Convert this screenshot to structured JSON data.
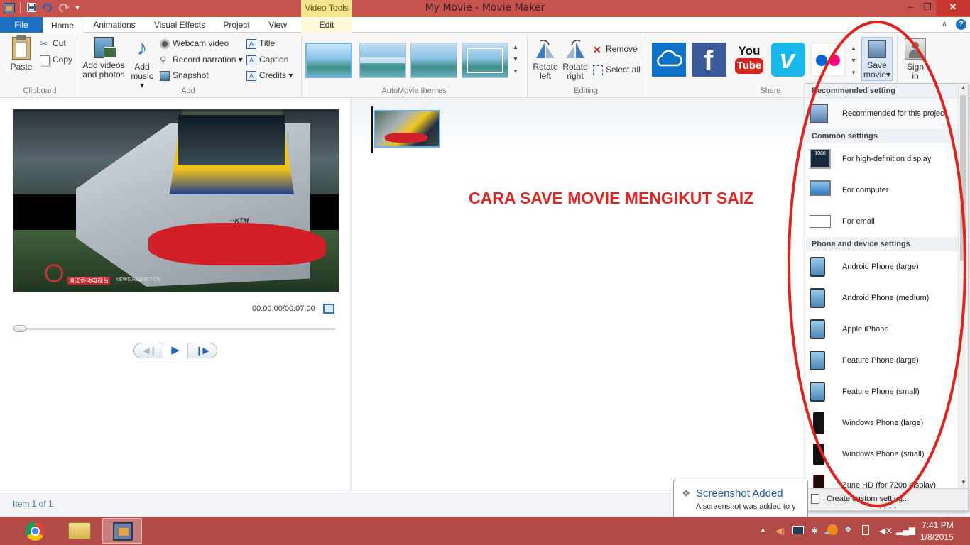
{
  "window": {
    "title": "My Movie - Movie Maker",
    "context_tab_group": "Video Tools",
    "controls": {
      "minimize": "–",
      "maximize": "❐",
      "close": "✕"
    }
  },
  "tabs": {
    "file": "File",
    "home": "Home",
    "animations": "Animations",
    "visual_effects": "Visual Effects",
    "project": "Project",
    "view": "View",
    "edit": "Edit"
  },
  "ribbon": {
    "clipboard": {
      "paste": "Paste",
      "cut": "Cut",
      "copy": "Copy",
      "label": "Clipboard"
    },
    "add": {
      "add_videos_1": "Add videos",
      "add_videos_2": "and photos",
      "add_music_1": "Add",
      "add_music_2": "music",
      "webcam": "Webcam video",
      "record": "Record narration",
      "snapshot": "Snapshot",
      "title": "Title",
      "caption": "Caption",
      "credits": "Credits",
      "label": "Add"
    },
    "themes": {
      "label": "AutoMovie themes"
    },
    "editing": {
      "rotate_left_1": "Rotate",
      "rotate_left_2": "left",
      "rotate_right_1": "Rotate",
      "rotate_right_2": "right",
      "remove": "Remove",
      "select_all": "Select all",
      "label": "Editing"
    },
    "share": {
      "save_movie_1": "Save",
      "save_movie_2": "movie",
      "sign_in_1": "Sign",
      "sign_in_2": "in",
      "label": "Share",
      "youtube_1": "You",
      "youtube_2": "Tube"
    }
  },
  "preview": {
    "time": "00:00.00/00:07.00",
    "watermark_cn": "清江弱动电视台",
    "watermark_url": "NEWS.REDNET.CN",
    "train_brand": "KTM"
  },
  "storyboard": {
    "annotation": "CARA SAVE MOVIE MENGIKUT SAIZ",
    "annotation_color": "#e0231e"
  },
  "status": {
    "item_count": "Item 1 of 1"
  },
  "save_menu": {
    "recommended_header": "Recommended setting",
    "recommended_item": "Recommended for this project",
    "common_header": "Common settings",
    "hd_badge": "1080",
    "items_common": [
      "For high-definition display",
      "For computer",
      "For email"
    ],
    "phone_header": "Phone and device settings",
    "items_device": [
      "Android Phone (large)",
      "Android Phone (medium)",
      "Apple iPhone",
      "Feature Phone (large)",
      "Feature Phone (small)",
      "Windows Phone (large)",
      "Windows Phone (small)",
      "Zune HD (for 720p display)"
    ],
    "custom": "Create custom setting..."
  },
  "toast": {
    "title": "Screenshot Added",
    "body": "A screenshot was added to y"
  },
  "taskbar": {
    "time": "7:41 PM",
    "date": "1/8/2015"
  },
  "colors": {
    "titlebar": "#c6524e",
    "taskbar": "#b24b48",
    "accent_blue": "#1d6fc2",
    "highlight_oval": "#e0231e"
  }
}
